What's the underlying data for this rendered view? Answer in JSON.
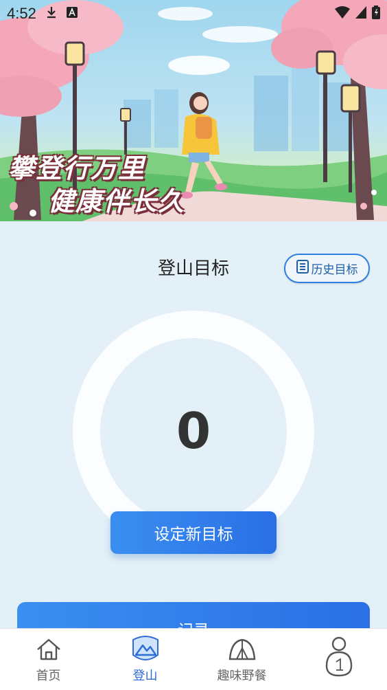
{
  "status_bar": {
    "time": "4:52"
  },
  "banner": {
    "slogan_line1": "攀登行万里",
    "slogan_line2": "健康伴长久"
  },
  "goal": {
    "title": "登山目标",
    "history_label": "历史目标",
    "current_value": "0",
    "set_goal_label": "设定新目标"
  },
  "record_label": "记录",
  "bottom_nav": {
    "items": [
      {
        "label": "首页",
        "icon": "home-icon",
        "active": false
      },
      {
        "label": "登山",
        "icon": "mountain-icon",
        "active": true
      },
      {
        "label": "趣味野餐",
        "icon": "tent-icon",
        "active": false
      },
      {
        "label": "",
        "icon": "profile-icon",
        "active": false
      }
    ]
  },
  "colors": {
    "accent": "#2d6bd6",
    "background": "#e3f0f7",
    "button_start": "#3a8ff0",
    "button_end": "#2a6fe6"
  }
}
